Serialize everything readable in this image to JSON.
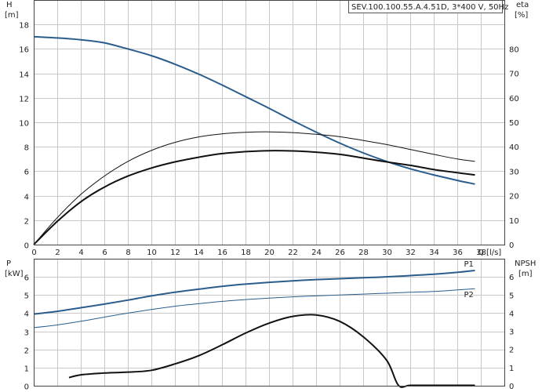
{
  "title": "SEV.100.100.55.A.4.51D, 3*400 V, 50Hz",
  "colors": {
    "blue": "#2a5d8c",
    "black": "#111111"
  },
  "chart_data": [
    {
      "type": "line",
      "axes": {
        "x": {
          "label": "Q [l/s]",
          "lim": [
            0,
            40
          ],
          "ticks": [
            0,
            2,
            4,
            6,
            8,
            10,
            12,
            14,
            16,
            18,
            20,
            22,
            24,
            26,
            28,
            30,
            32,
            34,
            36,
            38
          ]
        },
        "y_left": {
          "label": "H",
          "unit": "[m]",
          "lim": [
            0,
            20
          ],
          "ticks": [
            0,
            2,
            4,
            6,
            8,
            10,
            12,
            14,
            16,
            18
          ]
        },
        "y_right": {
          "label": "eta",
          "unit": "[%]",
          "lim": [
            0,
            100
          ],
          "ticks": [
            0,
            10,
            20,
            30,
            40,
            50,
            60,
            70,
            80
          ]
        }
      },
      "grid": true,
      "series": [
        {
          "axis": "left",
          "color": "blue",
          "width": 2,
          "x": [
            0,
            2,
            4,
            6,
            8,
            10,
            12,
            14,
            16,
            18,
            20,
            22,
            24,
            26,
            28,
            30,
            32,
            34,
            36,
            37.5
          ],
          "y": [
            17.0,
            16.9,
            16.75,
            16.5,
            16.0,
            15.45,
            14.75,
            13.95,
            13.05,
            12.1,
            11.15,
            10.15,
            9.2,
            8.3,
            7.5,
            6.8,
            6.2,
            5.7,
            5.25,
            4.95
          ]
        },
        {
          "axis": "right",
          "color": "black",
          "width": 1,
          "x": [
            0,
            2,
            4,
            6,
            8,
            10,
            12,
            14,
            16,
            18,
            20,
            22,
            24,
            26,
            28,
            30,
            32,
            34,
            36,
            37.5
          ],
          "y": [
            0,
            11,
            20.5,
            28,
            34,
            38.5,
            41.8,
            44,
            45.3,
            45.9,
            46.1,
            45.8,
            45.1,
            44.1,
            42.6,
            40.9,
            38.9,
            36.9,
            35,
            34
          ]
        },
        {
          "axis": "right",
          "color": "black",
          "width": 2,
          "x": [
            0,
            2,
            4,
            6,
            8,
            10,
            12,
            14,
            16,
            18,
            20,
            22,
            24,
            26,
            28,
            30,
            32,
            34,
            36,
            37.5
          ],
          "y": [
            0,
            9.5,
            17.5,
            23.5,
            28,
            31.3,
            33.8,
            35.7,
            37.2,
            38,
            38.4,
            38.3,
            37.8,
            36.9,
            35.4,
            33.8,
            32.4,
            30.7,
            29.4,
            28.5
          ]
        }
      ]
    },
    {
      "type": "line",
      "axes": {
        "x": {
          "lim": [
            0,
            40
          ]
        },
        "y_left": {
          "label": "P",
          "unit": "[kW]",
          "lim": [
            0,
            7
          ],
          "ticks": [
            0,
            1,
            2,
            3,
            4,
            5,
            6
          ]
        },
        "y_right": {
          "label": "NPSH",
          "unit": "[m]",
          "lim": [
            0,
            7
          ],
          "ticks": [
            0,
            1,
            2,
            3,
            4,
            5,
            6
          ]
        }
      },
      "grid": true,
      "series": [
        {
          "name": "P1",
          "axis": "left",
          "color": "blue",
          "width": 2,
          "x": [
            0,
            2,
            4,
            6,
            8,
            10,
            12,
            14,
            16,
            18,
            20,
            22,
            24,
            26,
            28,
            30,
            32,
            34,
            36,
            37.5
          ],
          "y": [
            3.95,
            4.1,
            4.3,
            4.5,
            4.72,
            4.95,
            5.15,
            5.32,
            5.48,
            5.6,
            5.7,
            5.78,
            5.85,
            5.9,
            5.95,
            6.0,
            6.07,
            6.15,
            6.25,
            6.35
          ]
        },
        {
          "name": "P2",
          "axis": "left",
          "color": "blue",
          "width": 1,
          "x": [
            0,
            2,
            4,
            6,
            8,
            10,
            12,
            14,
            16,
            18,
            20,
            22,
            24,
            26,
            28,
            30,
            32,
            34,
            36,
            37.5
          ],
          "y": [
            3.2,
            3.35,
            3.55,
            3.78,
            4.0,
            4.2,
            4.38,
            4.52,
            4.65,
            4.75,
            4.83,
            4.9,
            4.95,
            5.0,
            5.05,
            5.1,
            5.15,
            5.2,
            5.28,
            5.35
          ]
        },
        {
          "axis": "right",
          "color": "black",
          "width": 2,
          "x": [
            3,
            4,
            6,
            8,
            10,
            12,
            14,
            16,
            18,
            20,
            22,
            24,
            26,
            28,
            30,
            31,
            32,
            34,
            36,
            37.5
          ],
          "y": [
            0.45,
            0.6,
            0.7,
            0.75,
            0.85,
            1.2,
            1.65,
            2.25,
            2.9,
            3.45,
            3.82,
            3.9,
            3.55,
            2.7,
            1.4,
            0.02,
            0.02,
            0.02,
            0.02,
            0.02
          ]
        }
      ]
    }
  ]
}
